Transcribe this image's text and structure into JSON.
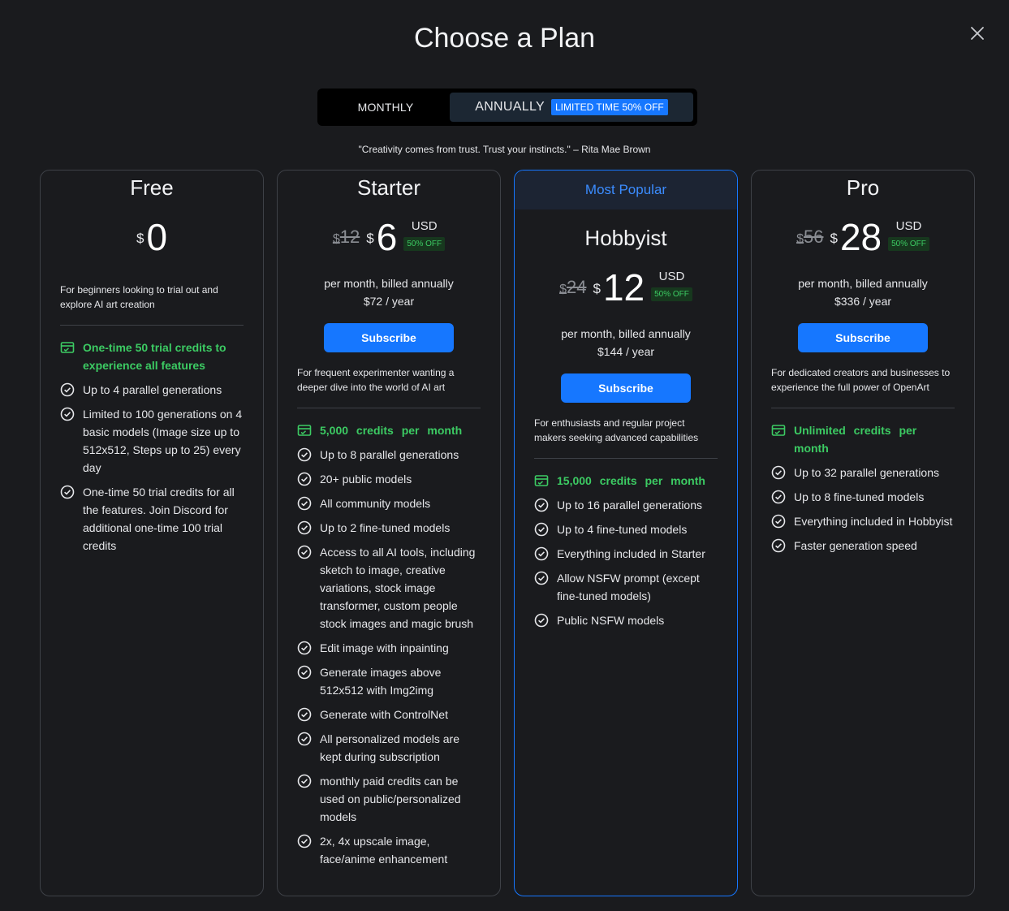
{
  "header": {
    "title": "Choose a Plan"
  },
  "toggle": {
    "monthly_label": "MONTHLY",
    "annually_label": "ANNUALLY",
    "limited_badge": "LIMITED TIME 50% OFF"
  },
  "quote": "\"Creativity comes from trust. Trust your instincts.\" – Rita Mae Brown",
  "currency_symbol": "$",
  "currency": "USD",
  "off_badge": "50% OFF",
  "billing_note": "per month, billed annually",
  "subscribe_label": "Subscribe",
  "colors": {
    "accent": "#1677ff",
    "green": "#3ccb63",
    "background": "#1a1b1e"
  },
  "plans": {
    "free": {
      "name": "Free",
      "price": "0",
      "description": "For beginners looking to trial out and explore AI art creation",
      "highlight": "One-time 50 trial credits to experience all features",
      "features": [
        "Up to 4 parallel generations",
        "Limited to 100 generations on 4 basic models (Image size up to 512x512, Steps up to 25) every day",
        "One-time 50 trial credits for all the features. Join Discord for additional one-time 100 trial credits"
      ]
    },
    "starter": {
      "name": "Starter",
      "old_price": "12",
      "price": "6",
      "yearly": "$72 / year",
      "description": "For frequent experimenter wanting a deeper dive into the world of AI art",
      "highlight": "5,000 credits per month",
      "features": [
        "Up to 8 parallel generations",
        "20+ public models",
        "All community models",
        "Up to 2 fine-tuned models",
        "Access to all AI tools, including sketch to image, creative variations, stock image transformer, custom people stock images and magic brush",
        "Edit image with inpainting",
        "Generate images above 512x512 with Img2img",
        "Generate with ControlNet",
        "All personalized models are kept during subscription",
        "monthly paid credits can be used on public/personalized models",
        "2x, 4x upscale image, face/anime enhancement"
      ]
    },
    "hobbyist": {
      "banner": "Most Popular",
      "name": "Hobbyist",
      "old_price": "24",
      "price": "12",
      "yearly": "$144 / year",
      "description": "For enthusiasts and regular project makers seeking advanced capabilities",
      "highlight": "15,000 credits per month",
      "features": [
        "Up to 16 parallel generations",
        "Up to 4 fine-tuned models",
        "Everything included in Starter",
        "Allow NSFW prompt (except fine-tuned models)",
        "Public NSFW models"
      ]
    },
    "pro": {
      "name": "Pro",
      "old_price": "56",
      "price": "28",
      "yearly": "$336 / year",
      "description": "For dedicated creators and businesses to experience the full power of OpenArt",
      "highlight": "Unlimited credits per month",
      "features": [
        "Up to 32 parallel generations",
        "Up to 8 fine-tuned models",
        "Everything included in Hobbyist",
        "Faster generation speed"
      ]
    }
  }
}
